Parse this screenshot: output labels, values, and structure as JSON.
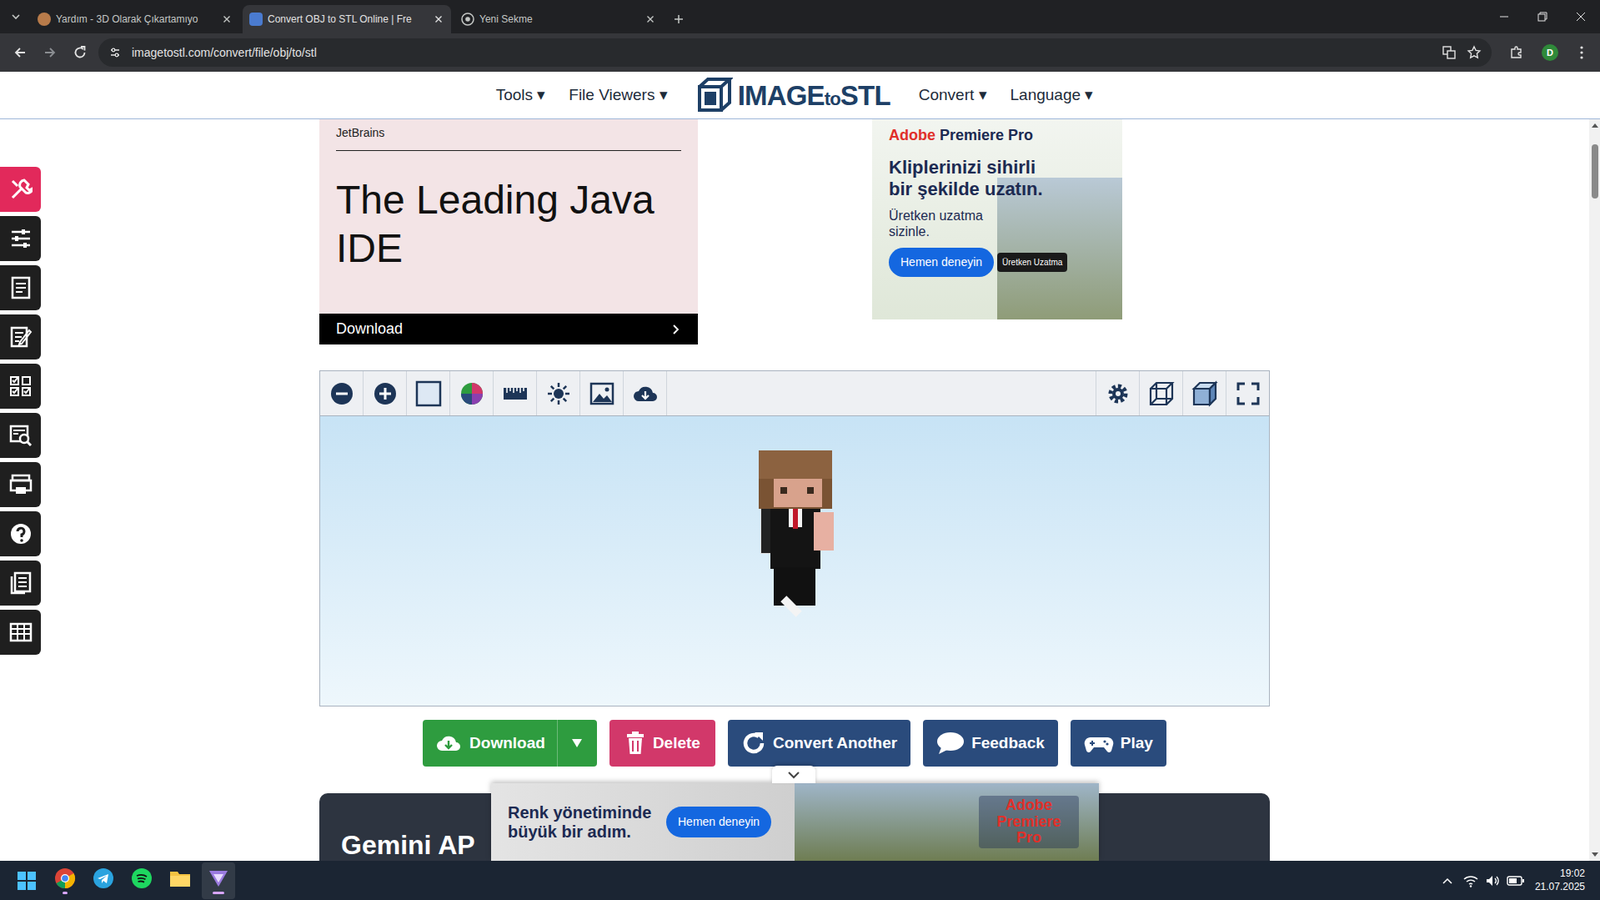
{
  "browser": {
    "tabs": [
      {
        "label": "Yardım - 3D Olarak Çıkartamıyo",
        "selected": false
      },
      {
        "label": "Convert OBJ to STL Online | Fre",
        "selected": true
      },
      {
        "label": "Yeni Sekme",
        "selected": false
      }
    ],
    "url": "imagetostl.com/convert/file/obj/to/stl",
    "profile": "D"
  },
  "nav": {
    "left": [
      "Tools ▾",
      "File Viewers ▾"
    ],
    "logo": [
      "IMAGE",
      "to",
      "STL"
    ],
    "right": [
      "Convert ▾",
      "Language ▾"
    ]
  },
  "sidebar": {
    "items": [
      {
        "selected": true
      },
      {
        "selected": false
      },
      {
        "selected": false
      },
      {
        "selected": false
      },
      {
        "selected": false
      },
      {
        "selected": false
      },
      {
        "selected": false
      },
      {
        "selected": false
      },
      {
        "selected": false
      },
      {
        "selected": false
      }
    ]
  },
  "ads": {
    "left": {
      "brand": "JetBrains",
      "headline": "The Leading Java IDE",
      "cta": "Download"
    },
    "right": {
      "brand": [
        "Adobe",
        "Premiere Pro"
      ],
      "headline": "Kliplerinizi sihirli bir şekilde uzatın.",
      "sub": "Üretken uzatma sizinle.",
      "cta": "Hemen deneyin",
      "badge": "Üretken Uzatma"
    }
  },
  "actions": [
    {
      "label": "Download",
      "color": "#2e9c3f"
    },
    {
      "label": "Delete",
      "color": "#d2386a"
    },
    {
      "label": "Convert Another",
      "color": "#2a4b7c"
    },
    {
      "label": "Feedback",
      "color": "#2a4b7c"
    },
    {
      "label": "Play",
      "color": "#2a4b7c"
    }
  ],
  "promo": {
    "title": "Gemini AP"
  },
  "bottom_ad": {
    "headline": "Renk yönetiminde büyük bir adım.",
    "cta": "Hemen deneyin",
    "brand": "Adobe Premiere Pro"
  },
  "taskbar": {
    "apps": [
      {
        "running": true
      },
      {
        "running": false
      },
      {
        "running": false
      },
      {
        "running": false
      },
      {
        "running": true
      }
    ],
    "time": "19:02",
    "date": "21.07.2025"
  }
}
